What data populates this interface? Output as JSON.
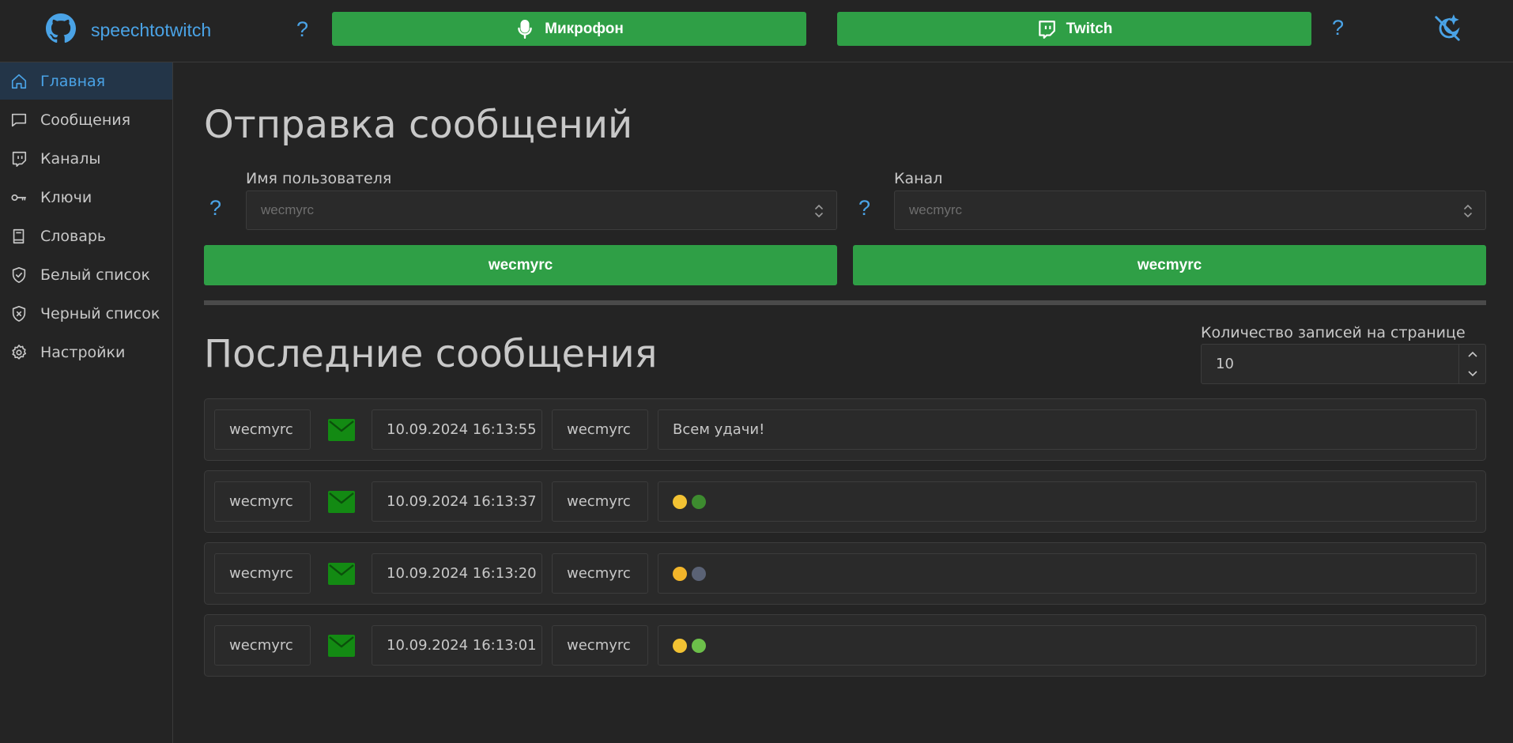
{
  "header": {
    "brand": "speechtotwitch",
    "help_symbol": "?",
    "mic_button_label": "Микрофон",
    "twitch_button_label": "Twitch"
  },
  "sidebar": {
    "items": [
      {
        "label": "Главная",
        "icon": "home-icon",
        "active": true
      },
      {
        "label": "Сообщения",
        "icon": "message-icon"
      },
      {
        "label": "Каналы",
        "icon": "twitch-icon"
      },
      {
        "label": "Ключи",
        "icon": "key-icon"
      },
      {
        "label": "Словарь",
        "icon": "book-icon"
      },
      {
        "label": "Белый список",
        "icon": "shield-check-icon"
      },
      {
        "label": "Черный список",
        "icon": "shield-x-icon"
      },
      {
        "label": "Настройки",
        "icon": "gear-icon"
      }
    ]
  },
  "send": {
    "title": "Отправка сообщений",
    "username_label": "Имя пользователя",
    "username_value": "wecmyrc",
    "channel_label": "Канал",
    "channel_value": "wecmyrc",
    "user_button_label": "wecmyrc",
    "channel_button_label": "wecmyrc"
  },
  "recent": {
    "title": "Последние сообщения",
    "per_page_label": "Количество записей на странице",
    "per_page_value": "10",
    "messages": [
      {
        "user": "wecmyrc",
        "time": "10.09.2024 16:13:55",
        "channel": "wecmyrc",
        "text": "Всем удачи!",
        "emojis": []
      },
      {
        "user": "wecmyrc",
        "time": "10.09.2024 16:13:37",
        "channel": "wecmyrc",
        "text": "",
        "emojis": [
          "#f2c233",
          "#3d8b2f"
        ]
      },
      {
        "user": "wecmyrc",
        "time": "10.09.2024 16:13:20",
        "channel": "wecmyrc",
        "text": "",
        "emojis": [
          "#f2b52a",
          "#5a6275"
        ]
      },
      {
        "user": "wecmyrc",
        "time": "10.09.2024 16:13:01",
        "channel": "wecmyrc",
        "text": "",
        "emojis": [
          "#f2c233",
          "#6cbf4a"
        ]
      }
    ]
  },
  "colors": {
    "accent": "#4aa3e6",
    "button_green": "#2f9f46",
    "envelope_green": "#138a13",
    "background": "#242424"
  }
}
